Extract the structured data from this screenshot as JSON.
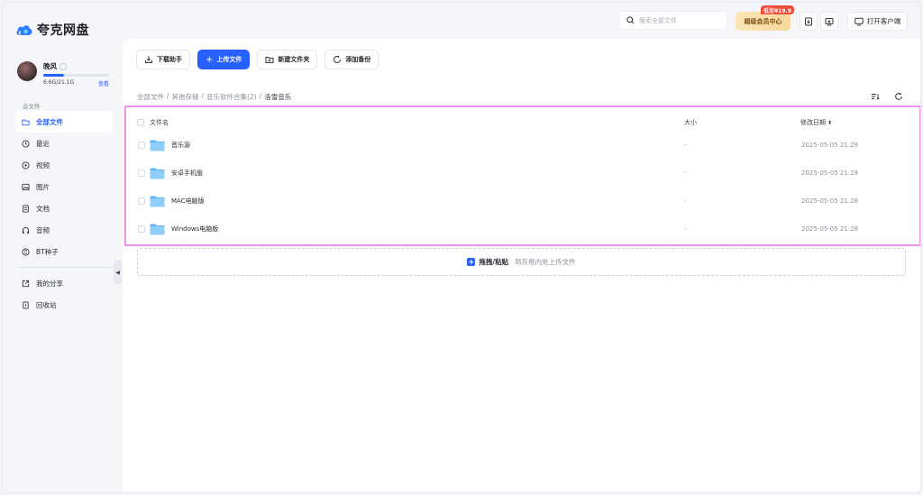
{
  "app": {
    "name": "夸克网盘"
  },
  "header": {
    "search_placeholder": "搜索全部文件",
    "vip_label": "超级会员中心",
    "vip_tag": "低至¥19.9",
    "client_label": "打开客户端"
  },
  "user": {
    "name": "晚风",
    "quota_text": "6.6G/21.1G",
    "quota_fraction": 0.31,
    "view_label": "查看"
  },
  "sidebar": {
    "section": "云文件",
    "items": [
      {
        "label": "全部文件",
        "icon": "folder-icon"
      },
      {
        "label": "最近",
        "icon": "clock-icon"
      },
      {
        "label": "视频",
        "icon": "play-icon"
      },
      {
        "label": "图片",
        "icon": "image-icon"
      },
      {
        "label": "文档",
        "icon": "document-icon"
      },
      {
        "label": "音频",
        "icon": "headphones-icon"
      },
      {
        "label": "BT种子",
        "icon": "bt-icon"
      }
    ],
    "items2": [
      {
        "label": "我的分享",
        "icon": "share-icon"
      },
      {
        "label": "回收站",
        "icon": "trash-icon"
      }
    ]
  },
  "toolbar": {
    "download_helper": "下载助手",
    "upload": "上传文件",
    "new_folder": "新建文件夹",
    "add_backup": "添加备份"
  },
  "breadcrumb": [
    "全部文件",
    "其他存储",
    "音乐软件合集(2)",
    "洛雪音乐"
  ],
  "table": {
    "col_name": "文件名",
    "col_size": "大小",
    "col_date": "修改日期",
    "rows": [
      {
        "name": "音乐源",
        "size": "-",
        "date": "2025-05-05 21:28"
      },
      {
        "name": "安卓手机版",
        "size": "-",
        "date": "2025-05-05 21:28"
      },
      {
        "name": "MAC电脑版",
        "size": "-",
        "date": "2025-05-05 21:28"
      },
      {
        "name": "Windows电脑版",
        "size": "-",
        "date": "2025-05-05 21:28"
      }
    ]
  },
  "dropzone": {
    "strong": "拖拽/粘贴",
    "hint": "到灰框内处上传文件"
  },
  "colors": {
    "accent": "#2861ff",
    "highlight": "#f08ff0"
  }
}
